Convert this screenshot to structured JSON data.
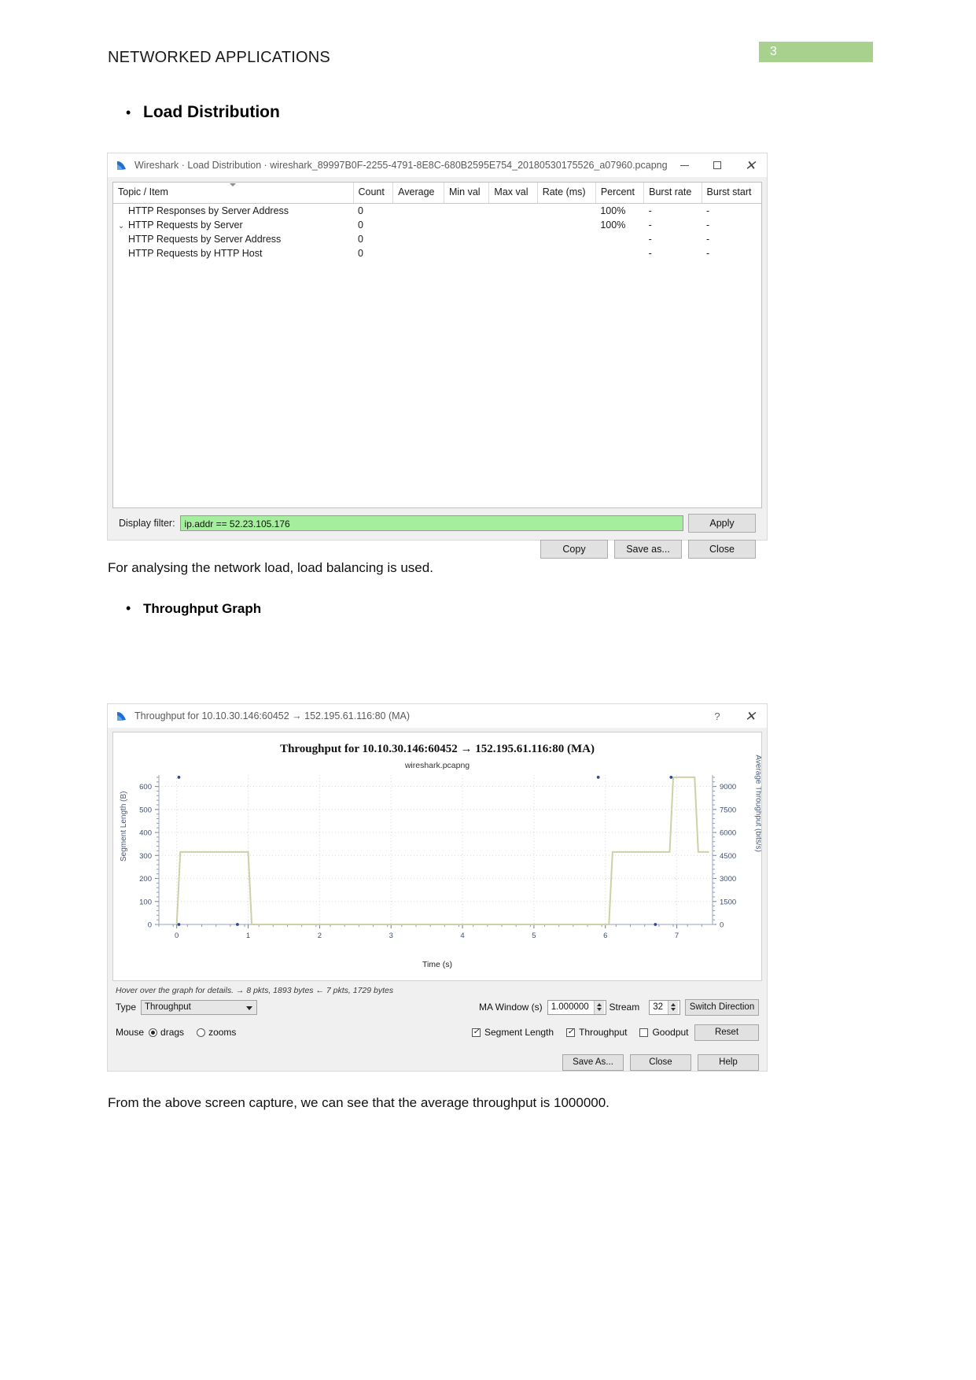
{
  "document": {
    "header_title": "NETWORKED APPLICATIONS",
    "page_number": "3",
    "page_badge_color": "#a9d18e",
    "bullet_1": "Load Distribution",
    "bullet_2": "Throughput Graph",
    "paragraph_1": "For analysing the network load, load balancing is used.",
    "paragraph_2": "From the above screen capture, we can see that the average throughput is 1000000."
  },
  "load_distribution_window": {
    "title": "Wireshark · Load Distribution · wireshark_89997B0F-2255-4791-8E8C-680B2595E754_20180530175526_a07960.pcapng",
    "window_controls": {
      "minimize": "minimize-icon",
      "maximize": "maximize-icon",
      "close": "close-icon"
    },
    "columns": [
      "Topic / Item",
      "Count",
      "Average",
      "Min val",
      "Max val",
      "Rate (ms)",
      "Percent",
      "Burst rate",
      "Burst start"
    ],
    "sorted_column_index": 0,
    "rows": [
      {
        "indent": 2,
        "twisty": "",
        "topic": "HTTP Responses by Server Address",
        "count": "0",
        "average": "",
        "min_val": "",
        "max_val": "",
        "rate": "",
        "percent": "100%",
        "burst_rate": "-",
        "burst_start": "-"
      },
      {
        "indent": 1,
        "twisty": "⌄",
        "topic": "HTTP Requests by Server",
        "count": "0",
        "average": "",
        "min_val": "",
        "max_val": "",
        "rate": "",
        "percent": "100%",
        "burst_rate": "-",
        "burst_start": "-"
      },
      {
        "indent": 3,
        "twisty": "",
        "topic": "HTTP Requests by Server Address",
        "count": "0",
        "average": "",
        "min_val": "",
        "max_val": "",
        "rate": "",
        "percent": "",
        "burst_rate": "-",
        "burst_start": "-"
      },
      {
        "indent": 3,
        "twisty": "",
        "topic": "HTTP Requests by HTTP Host",
        "count": "0",
        "average": "",
        "min_val": "",
        "max_val": "",
        "rate": "",
        "percent": "",
        "burst_rate": "-",
        "burst_start": "-"
      }
    ],
    "display_filter_label": "Display filter:",
    "display_filter_value": "ip.addr == 52.23.105.176",
    "display_filter_bg": "#a5ee9e",
    "apply_label": "Apply",
    "copy_label": "Copy",
    "save_as_label": "Save as...",
    "close_label": "Close"
  },
  "throughput_window": {
    "title": "Throughput for 10.10.30.146:60452 → 152.195.61.116:80 (MA)",
    "help_label": "?",
    "close_icon": "close-icon",
    "hint": "Hover over the graph for details. → 8 pkts, 1893 bytes ← 7 pkts, 1729 bytes",
    "type_label": "Type",
    "type_value": "Throughput",
    "mouse_label": "Mouse",
    "mouse_drags_label": "drags",
    "mouse_zooms_label": "zooms",
    "mouse_mode": "drags",
    "ma_window_label": "MA Window (s)",
    "ma_window_value": "1.000000",
    "stream_label": "Stream",
    "stream_value": "32",
    "switch_direction_label": "Switch Direction",
    "reset_label": "Reset",
    "segment_length_label": "Segment Length",
    "segment_length_checked": true,
    "throughput_label": "Throughput",
    "throughput_checked": true,
    "goodput_label": "Goodput",
    "goodput_checked": false,
    "save_as_label": "Save As...",
    "close_label": "Close",
    "help_button_label": "Help"
  },
  "chart_data": {
    "type": "line",
    "title": "Throughput for 10.10.30.146:60452 → 152.195.61.116:80 (MA)",
    "subtitle": "wireshark.pcapng",
    "xlabel": "Time (s)",
    "ylabel": "Segment Length (B)",
    "y2label": "Average Throughput (bits/s)",
    "xlim": [
      -0.25,
      7.5
    ],
    "ylim": [
      0,
      650
    ],
    "y2lim": [
      0,
      9750
    ],
    "xticks": [
      0,
      1,
      2,
      3,
      4,
      5,
      6,
      7
    ],
    "xticklabels": [
      "0",
      "1",
      "2",
      "3",
      "4",
      "5",
      "6",
      "7"
    ],
    "yticks": [
      0,
      100,
      200,
      300,
      400,
      500,
      600
    ],
    "yticklabels": [
      "0",
      "100",
      "200",
      "300",
      "400",
      "500",
      "600"
    ],
    "y2ticks": [
      0,
      1500,
      3000,
      4500,
      6000,
      7500,
      9000
    ],
    "y2ticklabels": [
      "0",
      "1500",
      "3000",
      "4500",
      "6000",
      "7500",
      "9000"
    ],
    "grid": true,
    "legend": null,
    "series": [
      {
        "name": "Throughput (MA)",
        "type": "step",
        "color": "#cfcfa8",
        "axis": "right",
        "x": [
          0.0,
          0.05,
          1.0,
          1.05,
          6.05,
          6.1,
          6.9,
          6.95,
          7.25,
          7.3,
          7.45
        ],
        "y": [
          0,
          315,
          315,
          0,
          0,
          315,
          315,
          640,
          640,
          315,
          315
        ]
      },
      {
        "name": "Segment Length",
        "type": "scatter",
        "color": "#31468c",
        "axis": "left",
        "points": [
          {
            "x": 0.03,
            "y": 640
          },
          {
            "x": 0.03,
            "y": 0
          },
          {
            "x": 0.85,
            "y": 0
          },
          {
            "x": 5.9,
            "y": 640
          },
          {
            "x": 6.7,
            "y": 0
          },
          {
            "x": 6.92,
            "y": 640
          }
        ]
      }
    ]
  }
}
